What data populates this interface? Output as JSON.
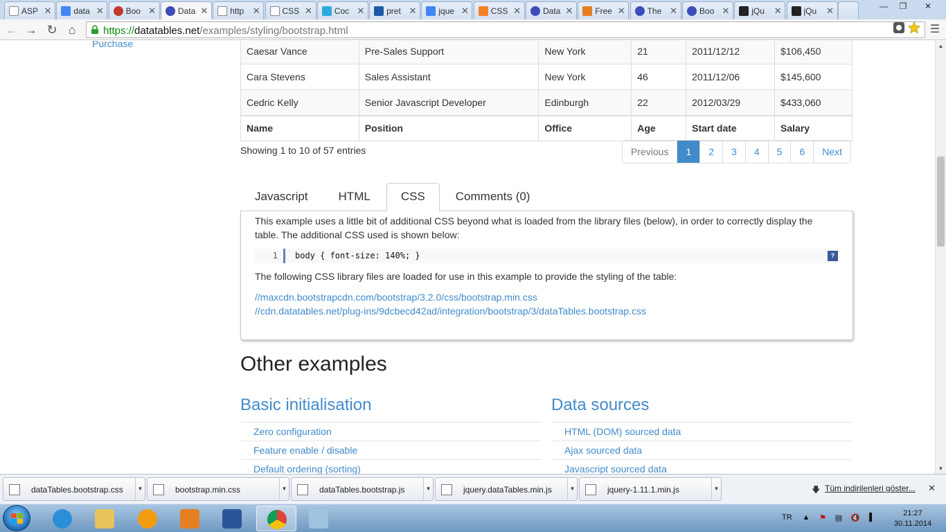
{
  "browser": {
    "tabs": [
      {
        "title": "ASP",
        "favicon": "page-icon",
        "active": false
      },
      {
        "title": "data",
        "favicon": "google-icon",
        "active": false
      },
      {
        "title": "Boo",
        "favicon": "opera-icon",
        "active": false
      },
      {
        "title": "Data",
        "favicon": "datatables-icon",
        "active": true
      },
      {
        "title": "http",
        "favicon": "page-icon",
        "active": false
      },
      {
        "title": "CSS",
        "favicon": "page-icon",
        "active": false
      },
      {
        "title": "Coc",
        "favicon": "c-icon",
        "active": false
      },
      {
        "title": "pret",
        "favicon": "pr-icon",
        "active": false
      },
      {
        "title": "jque",
        "favicon": "google-icon",
        "active": false
      },
      {
        "title": "CSS",
        "favicon": "stack-icon",
        "active": false
      },
      {
        "title": "Data",
        "favicon": "datatables-icon",
        "active": false
      },
      {
        "title": "Free",
        "favicon": "free-icon",
        "active": false
      },
      {
        "title": "The",
        "favicon": "datatables-icon",
        "active": false
      },
      {
        "title": "Boo",
        "favicon": "datatables-icon",
        "active": false
      },
      {
        "title": "jQu",
        "favicon": "jquery-icon",
        "active": false
      },
      {
        "title": "jQu",
        "favicon": "jquery-icon",
        "active": false
      }
    ],
    "url": {
      "scheme": "https://",
      "host": "datatables.net",
      "path": "/examples/styling/bootstrap.html"
    }
  },
  "page": {
    "side_link": "Purchase",
    "table": {
      "rows": [
        [
          "Caesar Vance",
          "Pre-Sales Support",
          "New York",
          "21",
          "2011/12/12",
          "$106,450"
        ],
        [
          "Cara Stevens",
          "Sales Assistant",
          "New York",
          "46",
          "2011/12/06",
          "$145,600"
        ],
        [
          "Cedric Kelly",
          "Senior Javascript Developer",
          "Edinburgh",
          "22",
          "2012/03/29",
          "$433,060"
        ]
      ],
      "footer": [
        "Name",
        "Position",
        "Office",
        "Age",
        "Start date",
        "Salary"
      ]
    },
    "info": "Showing 1 to 10 of 57 entries",
    "pagination": [
      "Previous",
      "1",
      "2",
      "3",
      "4",
      "5",
      "6",
      "Next"
    ],
    "pagination_active": "1",
    "tabs": [
      "Javascript",
      "HTML",
      "CSS",
      "Comments (0)"
    ],
    "active_tab": "CSS",
    "panel": {
      "intro": "This example uses a little bit of additional CSS beyond what is loaded from the library files (below), in order to correctly display the table. The additional CSS used is shown below:",
      "code_line_number": "1",
      "code": "body { font-size: 140%; }",
      "code_help": "?",
      "libraries_intro": "The following CSS library files are loaded for use in this example to provide the styling of the table:",
      "links": [
        "//maxcdn.bootstrapcdn.com/bootstrap/3.2.0/css/bootstrap.min.css",
        "//cdn.datatables.net/plug-ins/9dcbecd42ad/integration/bootstrap/3/dataTables.bootstrap.css"
      ]
    },
    "other_examples_heading": "Other examples",
    "columns": [
      {
        "heading": "Basic initialisation",
        "items": [
          "Zero configuration",
          "Feature enable / disable",
          "Default ordering (sorting)"
        ]
      },
      {
        "heading": "Data sources",
        "items": [
          "HTML (DOM) sourced data",
          "Ajax sourced data",
          "Javascript sourced data"
        ]
      }
    ]
  },
  "downloads": {
    "items": [
      {
        "name": "dataTables.bootstrap.css"
      },
      {
        "name": "bootstrap.min.css"
      },
      {
        "name": "dataTables.bootstrap.js"
      },
      {
        "name": "jquery.dataTables.min.js"
      },
      {
        "name": "jquery-1.11.1.min.js"
      }
    ],
    "show_all": "Tüm indirilenleri göster..."
  },
  "taskbar": {
    "apps": [
      "internet-explorer-icon",
      "file-explorer-icon",
      "media-center-icon",
      "media-player-icon",
      "word-icon",
      "chrome-icon",
      "notepad-icon"
    ],
    "active_app": "chrome-icon",
    "language": "TR",
    "time": "21:27",
    "date": "30.11.2014"
  },
  "colors": {
    "link": "#428bca",
    "pager_active": "#428bca",
    "https_green": "#0a8a0a",
    "taskbar": "#6f98c1"
  }
}
